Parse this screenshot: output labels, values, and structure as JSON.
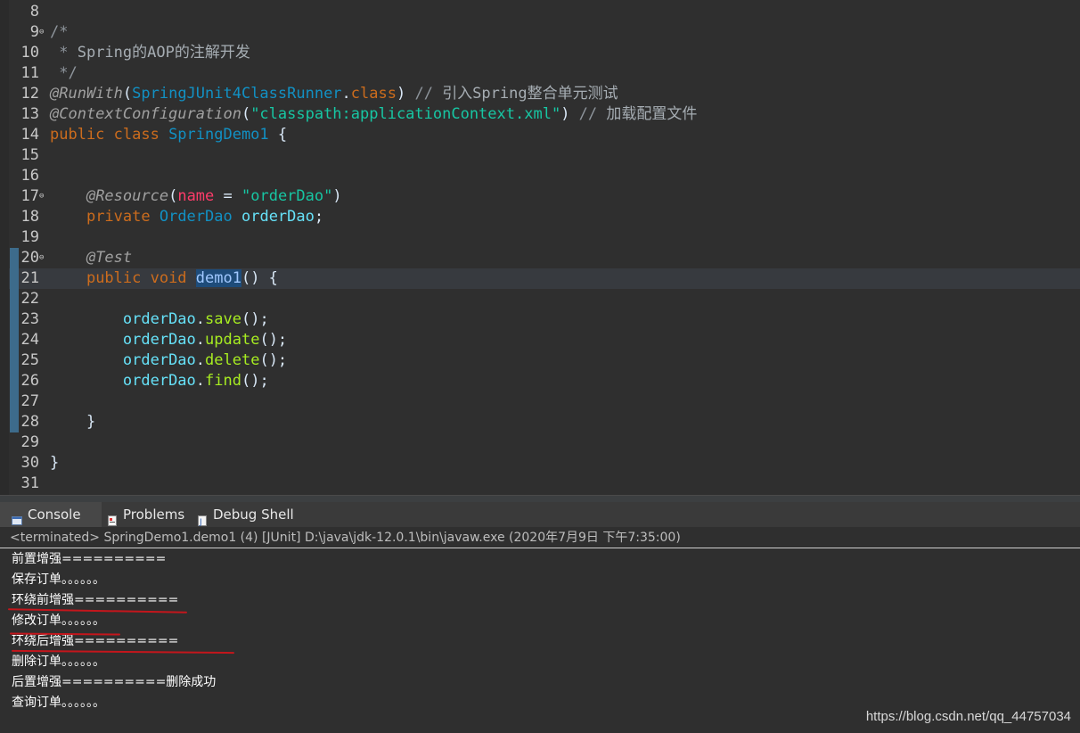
{
  "editor": {
    "lines": [
      {
        "n": "8",
        "fold": "",
        "segments": []
      },
      {
        "n": "9",
        "fold": "⊖",
        "segments": [
          {
            "c": "comment",
            "t": "/*"
          }
        ]
      },
      {
        "n": "10",
        "fold": "",
        "segments": [
          {
            "c": "comment",
            "t": " * "
          },
          {
            "c": "doc",
            "t": "Spring的AOP的注解开发"
          }
        ]
      },
      {
        "n": "11",
        "fold": "",
        "segments": [
          {
            "c": "comment",
            "t": " */"
          }
        ]
      },
      {
        "n": "12",
        "fold": "",
        "segments": [
          {
            "c": "annot",
            "t": "@RunWith"
          },
          {
            "c": "plain",
            "t": "("
          },
          {
            "c": "type",
            "t": "SpringJUnit4ClassRunner"
          },
          {
            "c": "plain",
            "t": "."
          },
          {
            "c": "kw",
            "t": "class"
          },
          {
            "c": "plain",
            "t": ") "
          },
          {
            "c": "comment",
            "t": "// "
          },
          {
            "c": "doc",
            "t": "引入Spring整合单元测试"
          }
        ]
      },
      {
        "n": "13",
        "fold": "",
        "segments": [
          {
            "c": "annot",
            "t": "@ContextConfiguration"
          },
          {
            "c": "plain",
            "t": "("
          },
          {
            "c": "str",
            "t": "\"classpath:applicationContext.xml\""
          },
          {
            "c": "plain",
            "t": ") "
          },
          {
            "c": "comment",
            "t": "// "
          },
          {
            "c": "doc",
            "t": "加载配置文件"
          }
        ]
      },
      {
        "n": "14",
        "fold": "",
        "segments": [
          {
            "c": "kw",
            "t": "public class "
          },
          {
            "c": "type",
            "t": "SpringDemo1"
          },
          {
            "c": "plain",
            "t": " {"
          }
        ]
      },
      {
        "n": "15",
        "fold": "",
        "segments": []
      },
      {
        "n": "16",
        "fold": "",
        "segments": []
      },
      {
        "n": "17",
        "fold": "⊖",
        "segments": [
          {
            "c": "plain",
            "t": "    "
          },
          {
            "c": "annot",
            "t": "@Resource"
          },
          {
            "c": "plain",
            "t": "("
          },
          {
            "c": "attr",
            "t": "name"
          },
          {
            "c": "plain",
            "t": " = "
          },
          {
            "c": "str",
            "t": "\"orderDao\""
          },
          {
            "c": "plain",
            "t": ")"
          }
        ]
      },
      {
        "n": "18",
        "fold": "",
        "segments": [
          {
            "c": "plain",
            "t": "    "
          },
          {
            "c": "kw",
            "t": "private "
          },
          {
            "c": "type",
            "t": "OrderDao"
          },
          {
            "c": "plain",
            "t": " "
          },
          {
            "c": "field",
            "t": "orderDao"
          },
          {
            "c": "plain",
            "t": ";"
          }
        ]
      },
      {
        "n": "19",
        "fold": "",
        "segments": []
      },
      {
        "n": "20",
        "fold": "⊖",
        "segments": [
          {
            "c": "plain",
            "t": "    "
          },
          {
            "c": "annot",
            "t": "@Test"
          }
        ]
      },
      {
        "n": "21",
        "fold": "",
        "segments": [
          {
            "c": "plain",
            "t": "    "
          },
          {
            "c": "kw",
            "t": "public void "
          },
          {
            "c": "sel",
            "t": "demo1"
          },
          {
            "c": "plain",
            "t": "() {"
          }
        ]
      },
      {
        "n": "22",
        "fold": "",
        "segments": []
      },
      {
        "n": "23",
        "fold": "",
        "segments": [
          {
            "c": "plain",
            "t": "        "
          },
          {
            "c": "field",
            "t": "orderDao"
          },
          {
            "c": "plain",
            "t": "."
          },
          {
            "c": "method",
            "t": "save"
          },
          {
            "c": "plain",
            "t": "();"
          }
        ]
      },
      {
        "n": "24",
        "fold": "",
        "segments": [
          {
            "c": "plain",
            "t": "        "
          },
          {
            "c": "field",
            "t": "orderDao"
          },
          {
            "c": "plain",
            "t": "."
          },
          {
            "c": "method",
            "t": "update"
          },
          {
            "c": "plain",
            "t": "();"
          }
        ]
      },
      {
        "n": "25",
        "fold": "",
        "segments": [
          {
            "c": "plain",
            "t": "        "
          },
          {
            "c": "field",
            "t": "orderDao"
          },
          {
            "c": "plain",
            "t": "."
          },
          {
            "c": "method",
            "t": "delete"
          },
          {
            "c": "plain",
            "t": "();"
          }
        ]
      },
      {
        "n": "26",
        "fold": "",
        "segments": [
          {
            "c": "plain",
            "t": "        "
          },
          {
            "c": "field",
            "t": "orderDao"
          },
          {
            "c": "plain",
            "t": "."
          },
          {
            "c": "method",
            "t": "find"
          },
          {
            "c": "plain",
            "t": "();"
          }
        ]
      },
      {
        "n": "27",
        "fold": "",
        "segments": []
      },
      {
        "n": "28",
        "fold": "",
        "segments": [
          {
            "c": "plain",
            "t": "    }"
          }
        ]
      },
      {
        "n": "29",
        "fold": "",
        "segments": []
      },
      {
        "n": "30",
        "fold": "",
        "segments": [
          {
            "c": "plain",
            "t": "}"
          }
        ]
      },
      {
        "n": "31",
        "fold": "",
        "segments": []
      }
    ]
  },
  "panel": {
    "tabs": [
      {
        "label": "Console",
        "icon": "console-icon"
      },
      {
        "label": "Problems",
        "icon": "problems-icon"
      },
      {
        "label": "Debug Shell",
        "icon": "debug-shell-icon"
      }
    ],
    "status": "<terminated> SpringDemo1.demo1 (4) [JUnit] D:\\java\\jdk-12.0.1\\bin\\javaw.exe (2020年7月9日 下午7:35:00)",
    "output": [
      "前置增强==========",
      "保存订单。。。。。。",
      "环绕前增强==========",
      "修改订单。。。。。。",
      "环绕后增强==========",
      "删除订单。。。。。。",
      "后置增强==========删除成功",
      "查询订单。。。。。。"
    ]
  },
  "watermark": "https://blog.csdn.net/qq_44757034"
}
